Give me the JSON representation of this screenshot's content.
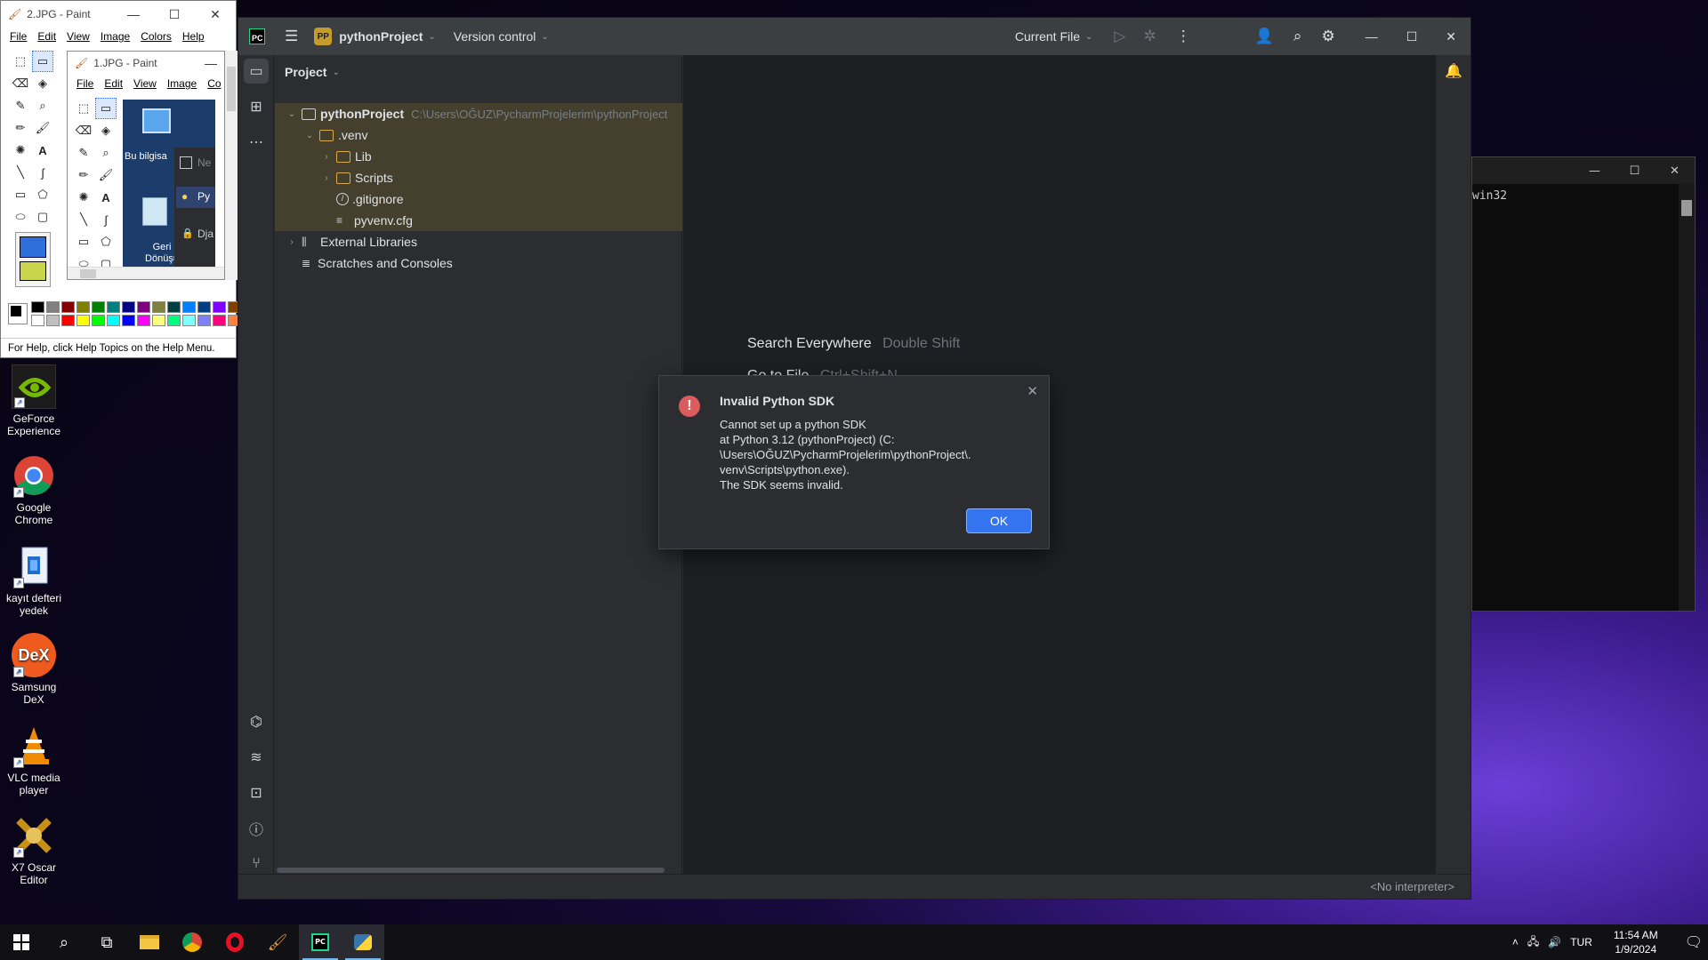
{
  "desktop_icons": [
    {
      "label": "GeForce Experience",
      "color": "#76b900",
      "icon": "nvidia-icon"
    },
    {
      "label": "Google Chrome",
      "color": "#4285f4",
      "icon": "chrome-icon"
    },
    {
      "label": "kayıt defteri yedek",
      "color": "#1f6fd1",
      "icon": "registry-file-icon"
    },
    {
      "label": "Samsung DeX",
      "color": "#ef5a1f",
      "icon": "dex-icon"
    },
    {
      "label": "VLC media player",
      "color": "#f08a00",
      "icon": "vlc-cone-icon"
    },
    {
      "label": "X7 Oscar Editor",
      "color": "#c69014",
      "icon": "x7-icon"
    }
  ],
  "paint_outer": {
    "title": "2.JPG - Paint",
    "menu": [
      "File",
      "Edit",
      "View",
      "Image",
      "Colors",
      "Help"
    ],
    "status": "For Help, click Help Topics on the Help Menu."
  },
  "paint_inner": {
    "title": "1.JPG - Paint",
    "menu": [
      "File",
      "Edit",
      "View",
      "Image",
      "Co"
    ],
    "canvas_labels": [
      "Bu bilgisa",
      "Geri Dönüşü",
      "Ne",
      "Py",
      "Dja"
    ]
  },
  "ide": {
    "project_badge": "PP",
    "project_name": "pythonProject",
    "vcs": "Version control",
    "run_config": "Current File",
    "panel_title": "Project",
    "tree": [
      {
        "label": "pythonProject",
        "path": "C:\\Users\\OĞUZ\\PycharmProjelerim\\pythonProject",
        "bold": true
      },
      {
        "label": ".venv"
      },
      {
        "label": "Lib"
      },
      {
        "label": "Scripts"
      },
      {
        "label": ".gitignore"
      },
      {
        "label": "pyvenv.cfg"
      },
      {
        "label": "External Libraries"
      },
      {
        "label": "Scratches and Consoles"
      }
    ],
    "hints": [
      {
        "action": "Search Everywhere",
        "shortcut": "Double Shift"
      },
      {
        "action": "Go to File",
        "shortcut": "Ctrl+Shift+N"
      }
    ],
    "status_interpreter": "<No interpreter>",
    "accent": "#3574f0",
    "highlight": "#45402d"
  },
  "dialog": {
    "title": "Invalid Python SDK",
    "message": "Cannot set up a python SDK\nat Python 3.12 (pythonProject) (C:\n\\Users\\OĞUZ\\PycharmProjelerim\\pythonProject\\.\nvenv\\Scripts\\python.exe).\nThe SDK seems invalid.",
    "ok": "OK",
    "error_color": "#db5c5c"
  },
  "console": {
    "text": "win32"
  },
  "taskbar": {
    "language": "TUR",
    "time": "11:54 AM",
    "date": "1/9/2024"
  }
}
